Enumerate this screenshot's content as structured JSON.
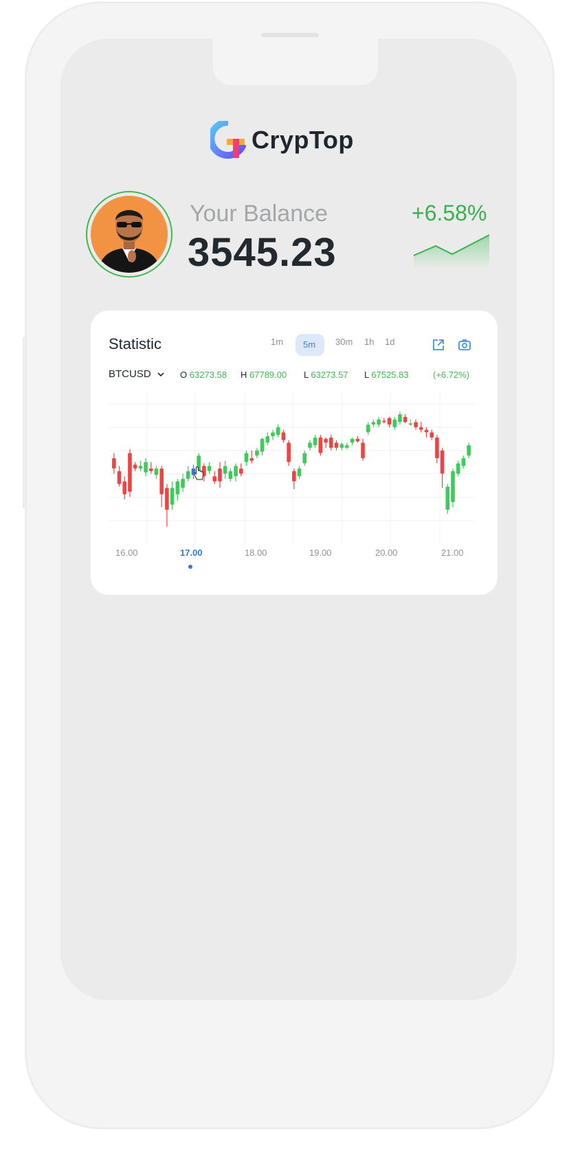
{
  "app": {
    "name": "CrypTop"
  },
  "balance": {
    "label": "Your Balance",
    "value": "3545.23",
    "change": "+6.58%"
  },
  "statistic": {
    "title": "Statistic",
    "timeframes": [
      "1m",
      "5m",
      "30m",
      "1h",
      "1d"
    ],
    "active_timeframe": "5m",
    "pair": "BTCUSD",
    "ohlc": {
      "o_label": "O",
      "o_value": "63273.58",
      "h_label": "H",
      "h_value": "67789.00",
      "l1_label": "L",
      "l1_value": "63273.57",
      "l2_label": "L",
      "l2_value": "67525.83",
      "change": "(+6.72%)"
    }
  },
  "icons": [
    "external-link-icon",
    "camera-icon",
    "chevron-down-icon",
    "cursor-hand-icon"
  ],
  "colors": {
    "up": "#3ecb5a",
    "down": "#ee4444",
    "selected": "#2f7be3",
    "accent": "#37b24d"
  },
  "chart_data": {
    "type": "candlestick",
    "x_ticks": [
      "16.00",
      "17.00",
      "18.00",
      "19.00",
      "20.00",
      "21.00"
    ],
    "active_tick": "17.00",
    "candles": [
      [
        0.58,
        0.5,
        0.46,
        0.62
      ],
      [
        0.48,
        0.38,
        0.36,
        0.52
      ],
      [
        0.4,
        0.3,
        0.26,
        0.44
      ],
      [
        0.62,
        0.32,
        0.28,
        0.65
      ],
      [
        0.53,
        0.5,
        0.48,
        0.55
      ],
      [
        0.5,
        0.52,
        0.48,
        0.56
      ],
      [
        0.47,
        0.55,
        0.44,
        0.58
      ],
      [
        0.5,
        0.48,
        0.46,
        0.55
      ],
      [
        0.45,
        0.5,
        0.42,
        0.52
      ],
      [
        0.5,
        0.3,
        0.2,
        0.52
      ],
      [
        0.35,
        0.18,
        0.05,
        0.38
      ],
      [
        0.22,
        0.35,
        0.18,
        0.4
      ],
      [
        0.3,
        0.4,
        0.25,
        0.42
      ],
      [
        0.35,
        0.42,
        0.32,
        0.46
      ],
      [
        0.42,
        0.48,
        0.4,
        0.52
      ],
      [
        0.45,
        0.5,
        0.42,
        0.53
      ],
      [
        0.47,
        0.6,
        0.45,
        0.62
      ],
      [
        0.52,
        0.44,
        0.4,
        0.54
      ],
      [
        0.48,
        0.52,
        0.46,
        0.55
      ],
      [
        0.44,
        0.4,
        0.38,
        0.48
      ],
      [
        0.5,
        0.4,
        0.35,
        0.55
      ],
      [
        0.46,
        0.52,
        0.42,
        0.56
      ],
      [
        0.42,
        0.48,
        0.4,
        0.5
      ],
      [
        0.44,
        0.52,
        0.4,
        0.54
      ],
      [
        0.5,
        0.46,
        0.44,
        0.54
      ],
      [
        0.55,
        0.62,
        0.52,
        0.64
      ],
      [
        0.58,
        0.56,
        0.54,
        0.64
      ],
      [
        0.6,
        0.64,
        0.58,
        0.66
      ],
      [
        0.63,
        0.73,
        0.6,
        0.74
      ],
      [
        0.7,
        0.75,
        0.68,
        0.78
      ],
      [
        0.75,
        0.78,
        0.72,
        0.8
      ],
      [
        0.76,
        0.82,
        0.74,
        0.84
      ],
      [
        0.78,
        0.72,
        0.7,
        0.8
      ],
      [
        0.7,
        0.55,
        0.52,
        0.72
      ],
      [
        0.48,
        0.4,
        0.34,
        0.5
      ],
      [
        0.44,
        0.5,
        0.42,
        0.52
      ],
      [
        0.54,
        0.62,
        0.52,
        0.64
      ],
      [
        0.66,
        0.7,
        0.64,
        0.72
      ],
      [
        0.68,
        0.74,
        0.66,
        0.76
      ],
      [
        0.74,
        0.62,
        0.6,
        0.76
      ],
      [
        0.73,
        0.7,
        0.66,
        0.74
      ],
      [
        0.74,
        0.66,
        0.64,
        0.76
      ],
      [
        0.7,
        0.66,
        0.64,
        0.72
      ],
      [
        0.66,
        0.69,
        0.64,
        0.7
      ],
      [
        0.66,
        0.68,
        0.65,
        0.7
      ],
      [
        0.7,
        0.73,
        0.68,
        0.74
      ],
      [
        0.73,
        0.71,
        0.7,
        0.75
      ],
      [
        0.7,
        0.58,
        0.56,
        0.73
      ],
      [
        0.78,
        0.84,
        0.76,
        0.86
      ],
      [
        0.84,
        0.86,
        0.82,
        0.88
      ],
      [
        0.84,
        0.88,
        0.82,
        0.9
      ],
      [
        0.87,
        0.86,
        0.85,
        0.89
      ],
      [
        0.89,
        0.84,
        0.82,
        0.9
      ],
      [
        0.82,
        0.88,
        0.8,
        0.9
      ],
      [
        0.86,
        0.92,
        0.84,
        0.94
      ],
      [
        0.9,
        0.86,
        0.85,
        0.92
      ],
      [
        0.84,
        0.85,
        0.83,
        0.88
      ],
      [
        0.86,
        0.82,
        0.8,
        0.88
      ],
      [
        0.82,
        0.8,
        0.78,
        0.86
      ],
      [
        0.8,
        0.78,
        0.74,
        0.82
      ],
      [
        0.78,
        0.74,
        0.72,
        0.8
      ],
      [
        0.74,
        0.58,
        0.54,
        0.76
      ],
      [
        0.64,
        0.46,
        0.35,
        0.66
      ],
      [
        0.18,
        0.36,
        0.15,
        0.38
      ],
      [
        0.24,
        0.48,
        0.2,
        0.5
      ],
      [
        0.46,
        0.54,
        0.44,
        0.56
      ],
      [
        0.52,
        0.58,
        0.5,
        0.6
      ],
      [
        0.6,
        0.68,
        0.58,
        0.7
      ]
    ],
    "selected_index": 15
  }
}
